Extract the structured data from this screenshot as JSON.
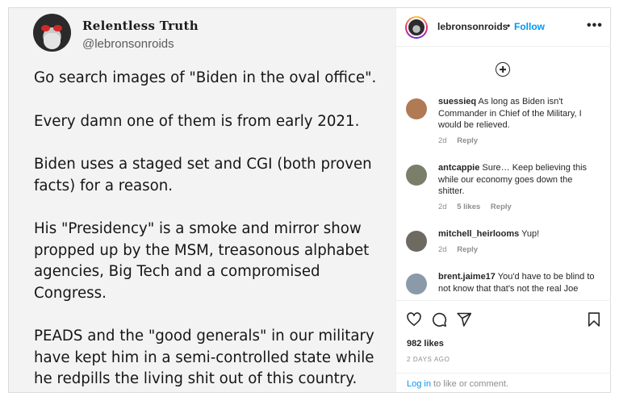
{
  "tweet": {
    "display_name": "Relentless Truth",
    "handle": "@lebronsonroids",
    "paragraphs": [
      "Go search images of \"Biden in the oval office\".",
      "Every damn one of them is from early 2021.",
      "Biden uses a staged set and CGI (both proven\nfacts) for a reason.",
      "His \"Presidency\" is a smoke and mirror show\npropped up by the MSM, treasonous alphabet\nagencies, Big Tech and a compromised\nCongress.",
      "PEADS and the \"good generals\" in our military\nhave kept him in a semi-controlled state while\nhe redpills the living shit out of this country."
    ]
  },
  "header": {
    "username": "lebronsonroids",
    "separator": "•",
    "follow_label": "Follow",
    "more_label": "•••"
  },
  "comments": [
    {
      "username": "suessieq",
      "text": "As long as Biden isn't Commander in Chief of the Military, I would be relieved.",
      "time": "2d",
      "likes": "",
      "reply_label": "Reply",
      "avatar_color": "#b07a55"
    },
    {
      "username": "antcappie",
      "text": "Sure… Keep believing this while our economy goes down the shitter.",
      "time": "2d",
      "likes": "5 likes",
      "reply_label": "Reply",
      "avatar_color": "#7a7f6a"
    },
    {
      "username": "mitchell_heirlooms",
      "text": "Yup!",
      "time": "2d",
      "likes": "",
      "reply_label": "Reply",
      "avatar_color": "#6d6a62"
    },
    {
      "username": "brent.jaime17",
      "text": "You'd have to be blind to not know that that's not the real Joe",
      "time": "",
      "likes": "",
      "reply_label": "",
      "avatar_color": "#8a9aa8"
    }
  ],
  "post": {
    "likes": "982 likes",
    "time": "2 DAYS AGO"
  },
  "login": {
    "link": "Log in",
    "rest": " to like or comment."
  },
  "colors": {
    "accent": "#0095f6",
    "text": "#262626",
    "muted": "#8e8e8e",
    "border": "#dbdbdb"
  }
}
